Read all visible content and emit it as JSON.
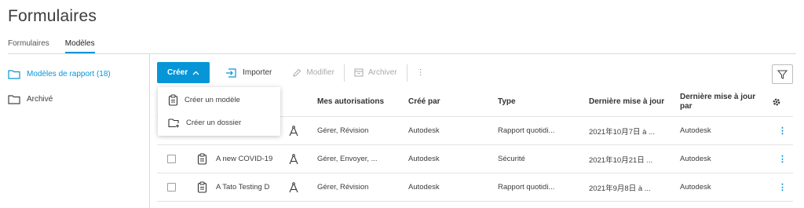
{
  "page": {
    "title": "Formulaires"
  },
  "tabs": [
    {
      "label": "Formulaires"
    },
    {
      "label": "Modèles"
    }
  ],
  "sidebar": {
    "items": [
      {
        "label": "Modèles de rapport (18)"
      },
      {
        "label": "Archivé"
      }
    ]
  },
  "toolbar": {
    "create_label": "Créer",
    "import_label": "Importer",
    "edit_label": "Modifier",
    "archive_label": "Archiver",
    "more_label": "⋮"
  },
  "dropdown": {
    "items": [
      {
        "label": "Créer un modèle"
      },
      {
        "label": "Créer un dossier"
      }
    ]
  },
  "table": {
    "columns": {
      "permissions": "Mes autorisations",
      "created_by": "Créé par",
      "type": "Type",
      "last_updated": "Dernière mise à jour",
      "last_updated_by": "Dernière mise à jour par"
    },
    "rows": [
      {
        "name": "",
        "permissions": "Gérer, Révision",
        "created_by": "Autodesk",
        "type": "Rapport quotidi...",
        "last_updated": "2021年10月7日 à ...",
        "last_updated_by": "Autodesk"
      },
      {
        "name": "A new COVID-19",
        "permissions": "Gérer, Envoyer, ...",
        "created_by": "Autodesk",
        "type": "Sécurité",
        "last_updated": "2021年10月21日 ...",
        "last_updated_by": "Autodesk"
      },
      {
        "name": "A Tato Testing D",
        "permissions": "Gérer, Révision",
        "created_by": "Autodesk",
        "type": "Rapport quotidi...",
        "last_updated": "2021年9月8日 à ...",
        "last_updated_by": "Autodesk"
      }
    ],
    "row_menu": "⋮"
  },
  "colors": {
    "accent": "#0696d7"
  },
  "icons": [
    "folder-icon",
    "chevron-up-icon",
    "import-icon",
    "pencil-icon",
    "archive-icon",
    "filter-icon",
    "template-icon",
    "new-folder-icon",
    "compass-icon",
    "settings-icon"
  ]
}
